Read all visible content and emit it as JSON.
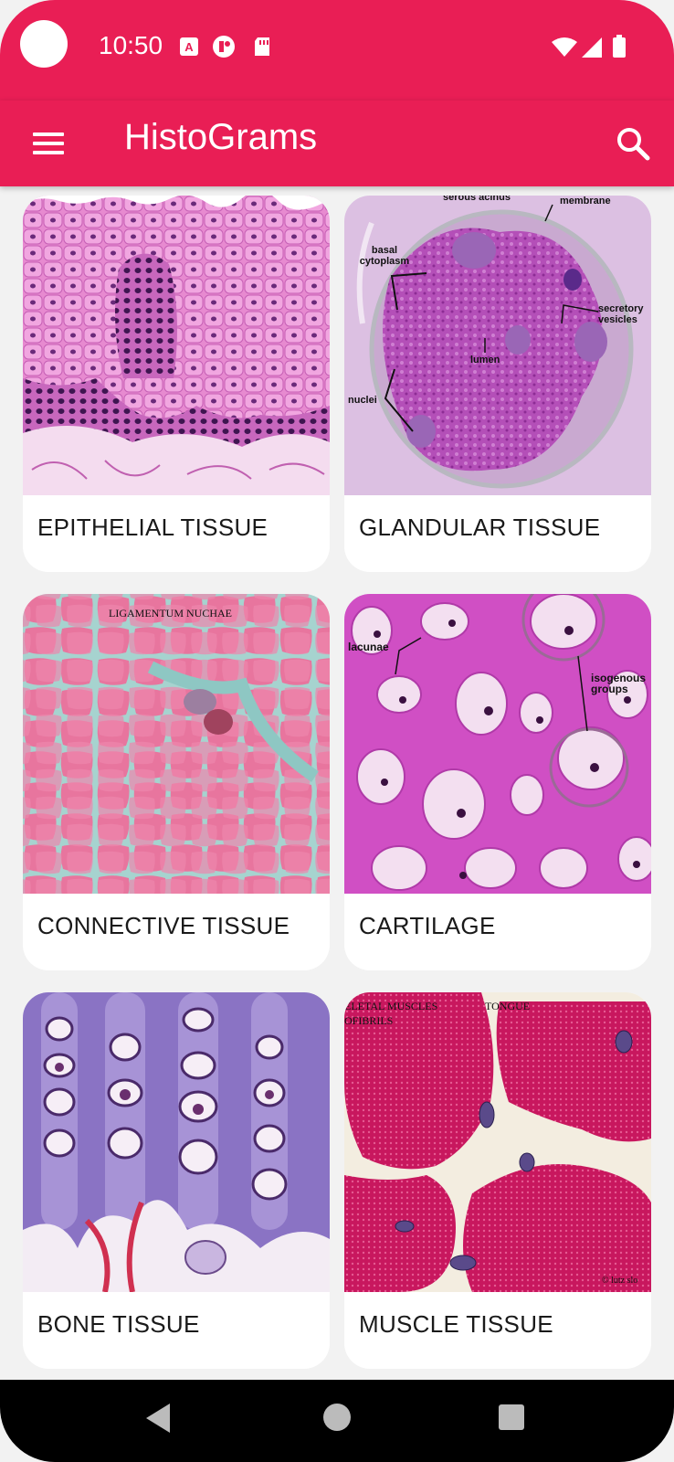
{
  "status_bar": {
    "time": "10:50",
    "icons": [
      "camera-cutout",
      "a-notification-icon",
      "app-notification-icon",
      "sd-card-icon",
      "wifi-icon",
      "signal-icon",
      "battery-icon"
    ]
  },
  "app_bar": {
    "title": "HistoGrams",
    "menu_icon": "hamburger-menu-icon",
    "search_icon": "search-icon"
  },
  "colors": {
    "primary": "#e91e55",
    "background": "#f2f2f2",
    "card": "#ffffff",
    "nav_bar": "#000000"
  },
  "cards": [
    {
      "label": "EPITHELIAL TISSUE",
      "image_annotations": []
    },
    {
      "label": "GLANDULAR TISSUE",
      "image_annotations": [
        "serous acinus",
        "membrane",
        "basal cytoplasm",
        "secretory vesicles",
        "lumen",
        "nuclei"
      ]
    },
    {
      "label": "CONNECTIVE TISSUE",
      "image_annotations": [
        "LIGAMENTUM NUCHAE"
      ]
    },
    {
      "label": "CARTILAGE",
      "image_annotations": [
        "lacunae",
        "isogenous groups"
      ]
    },
    {
      "label": "BONE TISSUE",
      "image_annotations": []
    },
    {
      "label": "MUSCLE TISSUE",
      "image_annotations": [
        "ELETAL MUSCLES",
        "OFIBRILS",
        "TONGUE",
        "© lutz slo"
      ]
    }
  ],
  "nav_bar": {
    "back_icon": "back-triangle-icon",
    "home_icon": "home-circle-icon",
    "recents_icon": "recents-square-icon"
  }
}
